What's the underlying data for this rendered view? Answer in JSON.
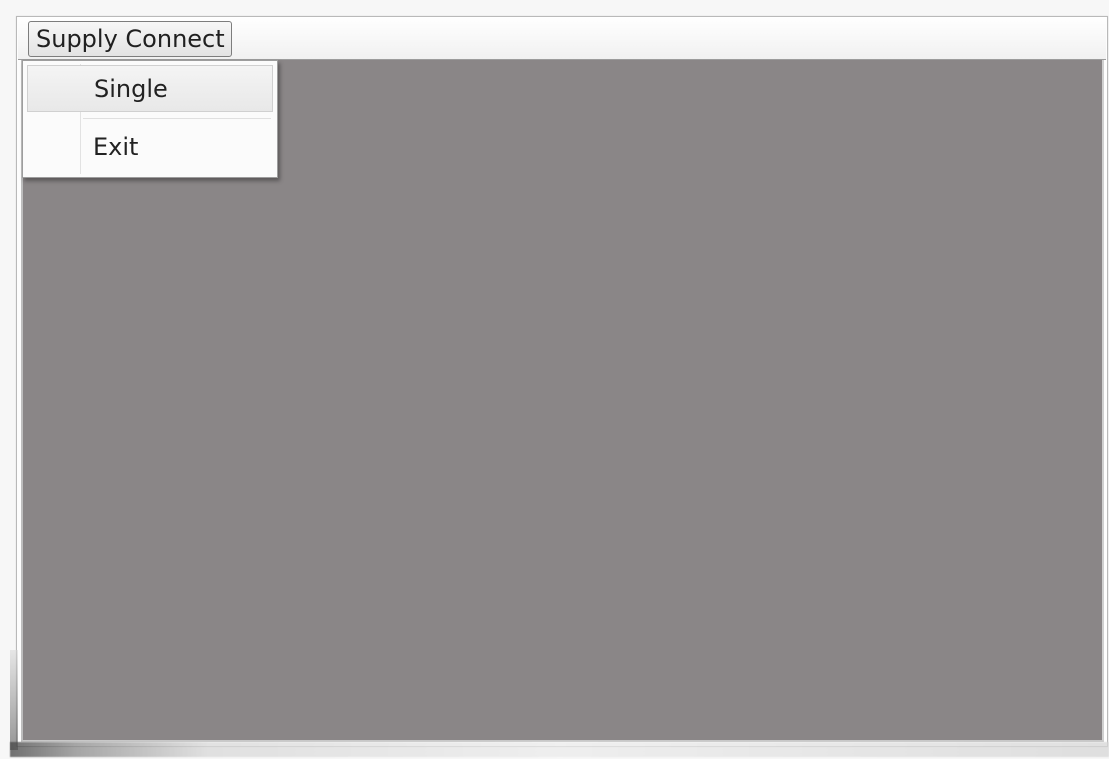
{
  "menu_bar": {
    "items": [
      {
        "label": "Supply Connect",
        "state": "open"
      }
    ]
  },
  "dropdown": {
    "items": [
      {
        "label": "Single",
        "state": "hovered"
      },
      {
        "label": "Exit"
      }
    ]
  },
  "colors": {
    "client_area": "#8a8687",
    "menu_background": "#fbfbfb",
    "menu_border": "#9d9d9d",
    "text": "#222222"
  }
}
